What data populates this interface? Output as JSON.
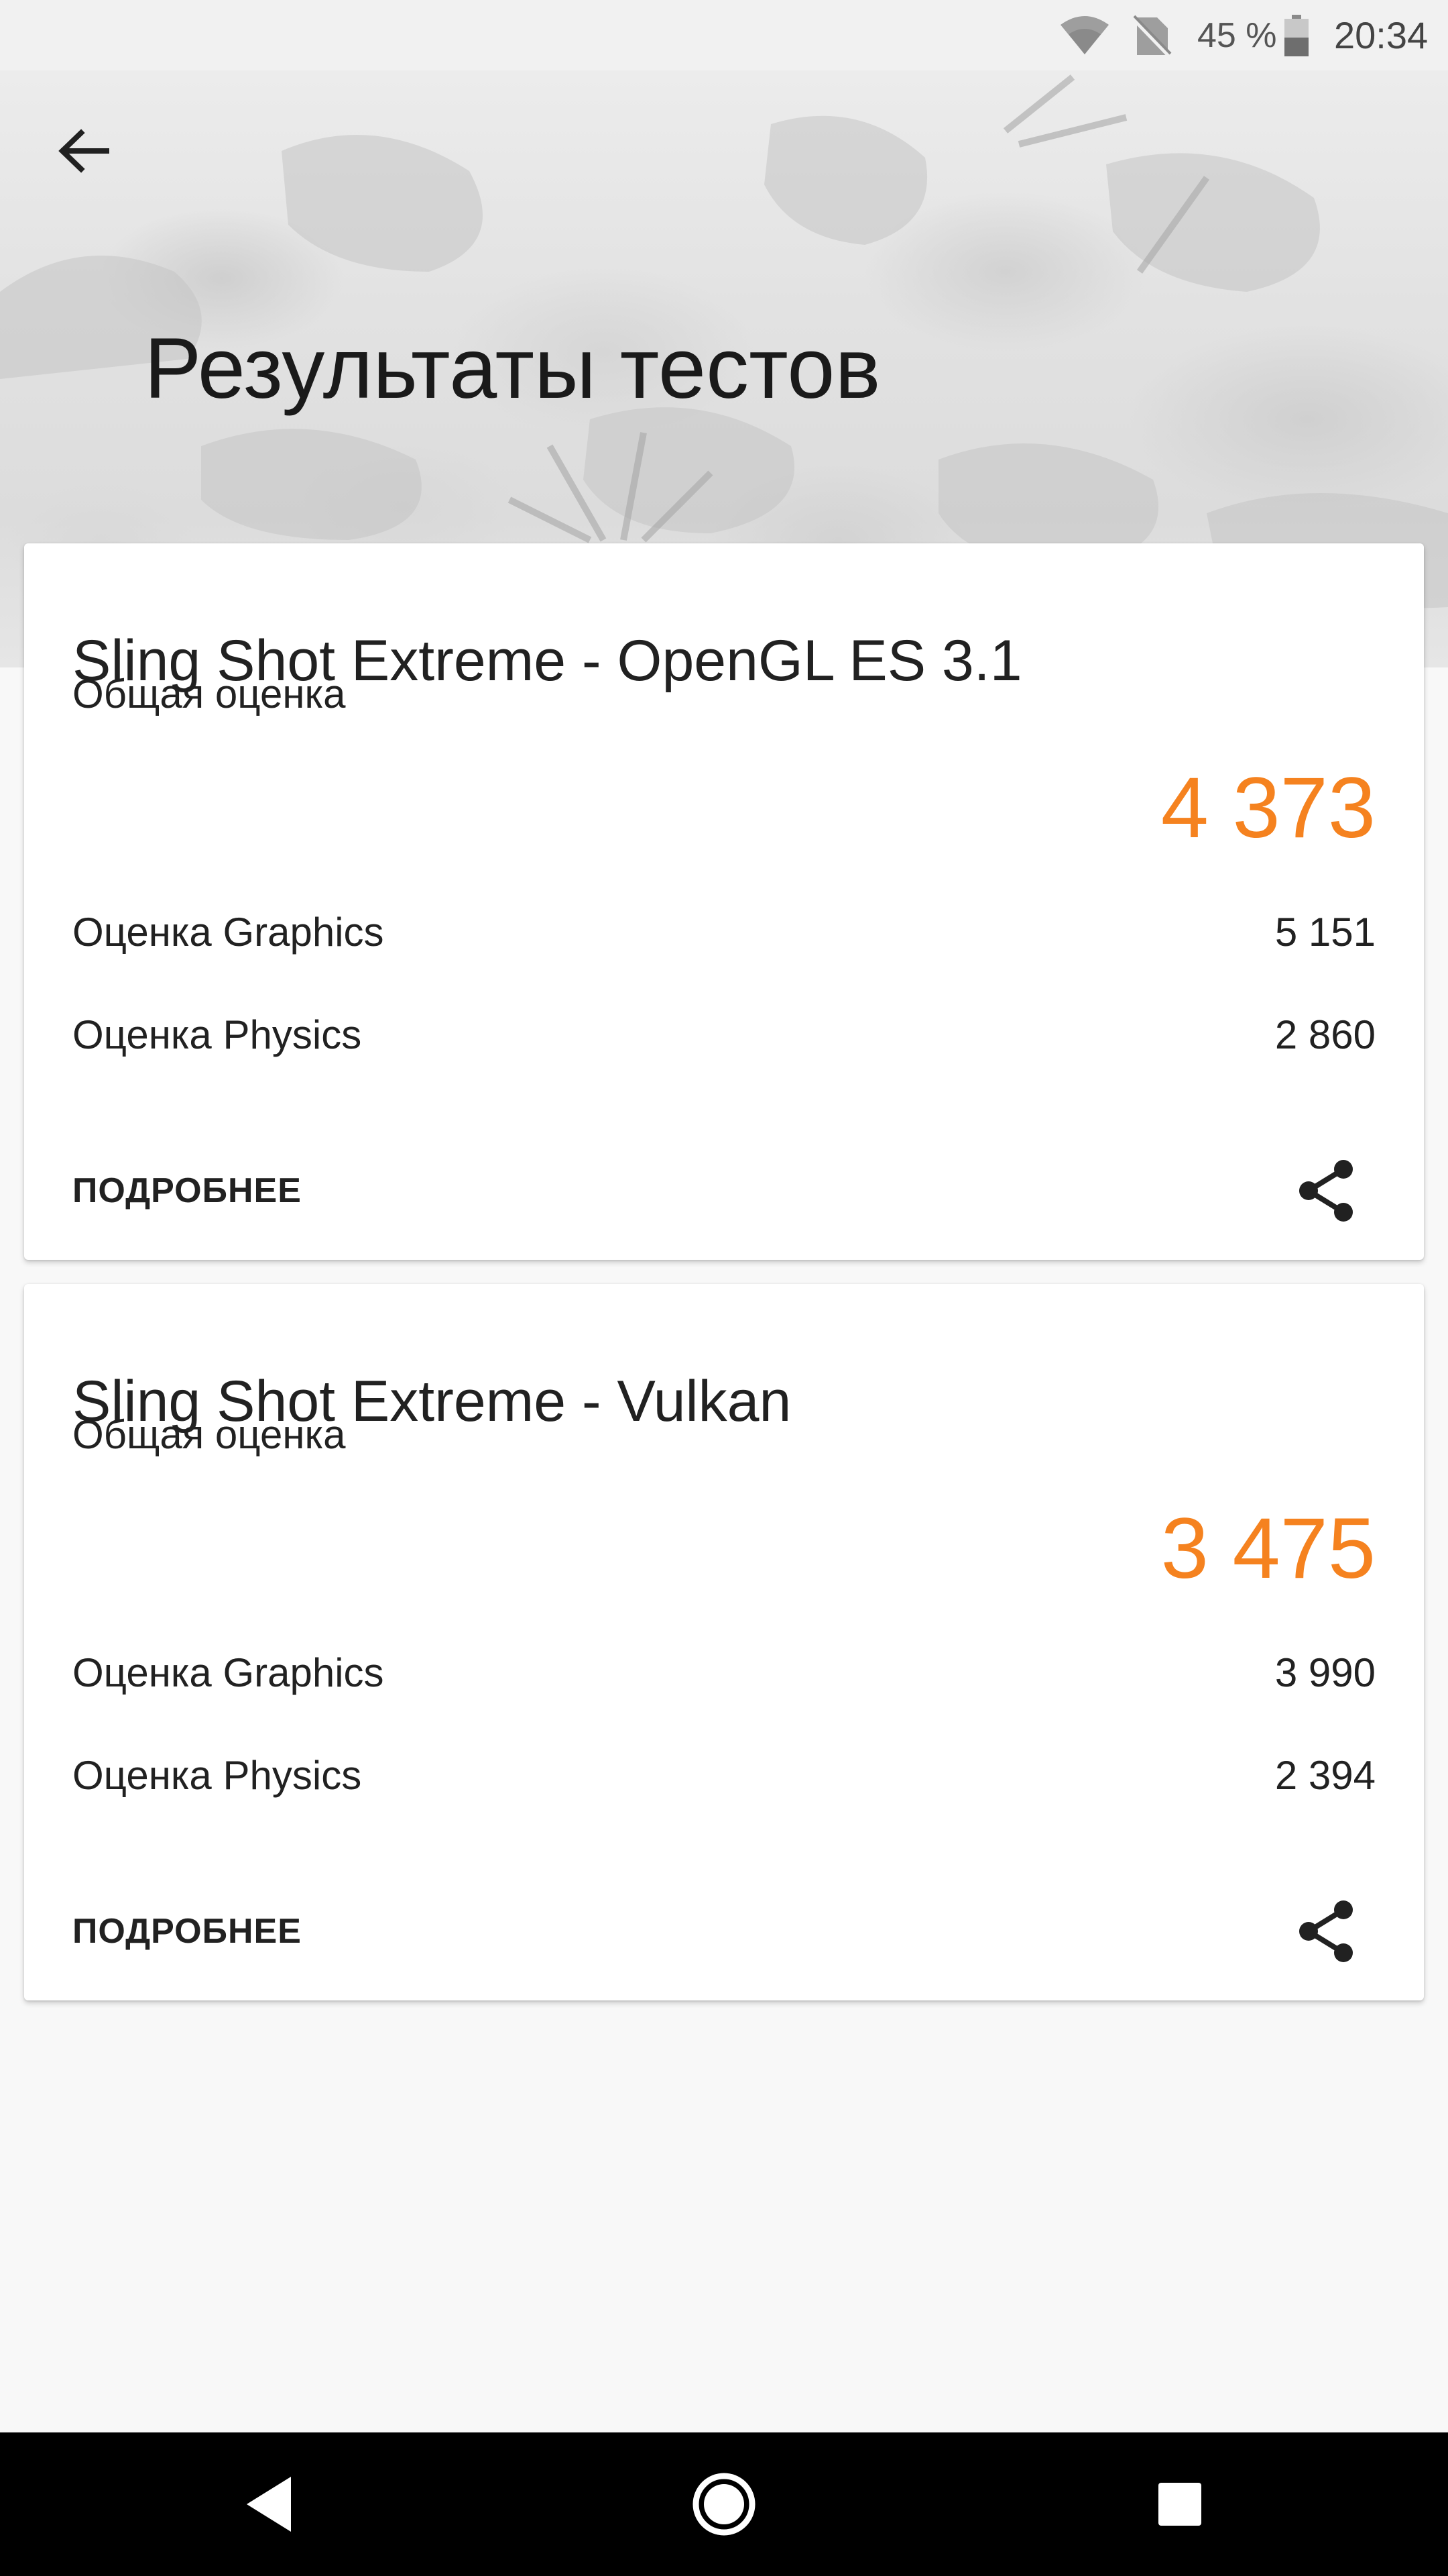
{
  "status_bar": {
    "battery_percent": "45 %",
    "time": "20:34",
    "icons": [
      "wifi-icon",
      "no-sim-icon",
      "battery-icon"
    ]
  },
  "header": {
    "title": "Результаты тестов",
    "back_icon": "arrow-back-icon"
  },
  "accent_color": "#f5821f",
  "results": [
    {
      "title": "Sling Shot Extreme - OpenGL ES 3.1",
      "overall_label": "Общая оценка",
      "overall_value": "4 373",
      "graphics_label": "Оценка Graphics",
      "graphics_value": "5 151",
      "physics_label": "Оценка Physics",
      "physics_value": "2 860",
      "details_label": "ПОДРОБНЕЕ",
      "share_icon": "share-icon"
    },
    {
      "title": "Sling Shot Extreme - Vulkan",
      "overall_label": "Общая оценка",
      "overall_value": "3 475",
      "graphics_label": "Оценка Graphics",
      "graphics_value": "3 990",
      "physics_label": "Оценка Physics",
      "physics_value": "2 394",
      "details_label": "ПОДРОБНЕЕ",
      "share_icon": "share-icon"
    }
  ],
  "nav_bar": {
    "buttons": [
      "nav-back-icon",
      "nav-home-icon",
      "nav-recents-icon"
    ]
  }
}
